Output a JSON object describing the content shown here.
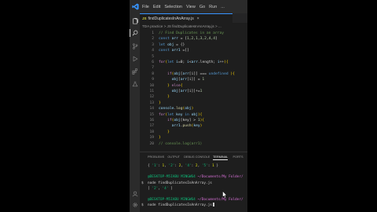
{
  "menu": [
    "File",
    "Edit",
    "Selection",
    "View",
    "Go",
    "Run",
    "..."
  ],
  "tab": {
    "badge": "JS",
    "label": "findDuplicatesInAnArray.js",
    "close": "×"
  },
  "breadcrumb": "TDA practice > JS findDuplicatesInAnArray.js > ...",
  "code_lines": [
    {
      "n": "1",
      "tokens": [
        {
          "t": "// Find Duplicates in an array",
          "c": "cmt"
        }
      ]
    },
    {
      "n": "2",
      "tokens": [
        {
          "t": "const ",
          "c": "kw"
        },
        {
          "t": "arr",
          "c": "var"
        },
        {
          "t": " = [",
          "c": "pun"
        },
        {
          "t": "1,2,1,3,2,4,4",
          "c": "num"
        },
        {
          "t": "]",
          "c": "pun"
        }
      ]
    },
    {
      "n": "3",
      "tokens": [
        {
          "t": "let ",
          "c": "kw"
        },
        {
          "t": "obj",
          "c": "var"
        },
        {
          "t": " = {}",
          "c": "pun"
        }
      ]
    },
    {
      "n": "4",
      "tokens": [
        {
          "t": "const ",
          "c": "kw"
        },
        {
          "t": "arr1",
          "c": "var"
        },
        {
          "t": " =[]",
          "c": "pun"
        }
      ]
    },
    {
      "n": "5",
      "tokens": []
    },
    {
      "n": "6",
      "tokens": [
        {
          "t": "for",
          "c": "ctl"
        },
        {
          "t": "(",
          "c": "br"
        },
        {
          "t": "let ",
          "c": "kw"
        },
        {
          "t": "i",
          "c": "var"
        },
        {
          "t": "=0; ",
          "c": "pun"
        },
        {
          "t": "i",
          "c": "var"
        },
        {
          "t": "<",
          "c": "pun"
        },
        {
          "t": "arr",
          "c": "var"
        },
        {
          "t": ".length; ",
          "c": "pun"
        },
        {
          "t": "i",
          "c": "var"
        },
        {
          "t": "++",
          "c": "pun"
        },
        {
          "t": "){",
          "c": "br"
        }
      ]
    },
    {
      "n": "7",
      "tokens": []
    },
    {
      "n": "8",
      "tokens": [
        {
          "t": "    if",
          "c": "ctl"
        },
        {
          "t": "(",
          "c": "br"
        },
        {
          "t": "obj",
          "c": "var"
        },
        {
          "t": "[",
          "c": "pun"
        },
        {
          "t": "arr",
          "c": "var"
        },
        {
          "t": "[i]] === ",
          "c": "pun"
        },
        {
          "t": "undefined",
          "c": "kw"
        },
        {
          "t": " ){",
          "c": "br"
        }
      ]
    },
    {
      "n": "9",
      "tokens": [
        {
          "t": "      obj",
          "c": "var"
        },
        {
          "t": "[",
          "c": "pun"
        },
        {
          "t": "arr",
          "c": "var"
        },
        {
          "t": "[i]] = ",
          "c": "pun"
        },
        {
          "t": "1",
          "c": "num"
        }
      ]
    },
    {
      "n": "10",
      "tokens": [
        {
          "t": "    } ",
          "c": "br"
        },
        {
          "t": "else",
          "c": "ctl"
        },
        {
          "t": "{",
          "c": "br"
        }
      ]
    },
    {
      "n": "11",
      "tokens": [
        {
          "t": "      obj",
          "c": "var"
        },
        {
          "t": "[",
          "c": "pun"
        },
        {
          "t": "arr",
          "c": "var"
        },
        {
          "t": "[i]]+=",
          "c": "pun"
        },
        {
          "t": "1",
          "c": "num"
        }
      ]
    },
    {
      "n": "12",
      "tokens": [
        {
          "t": "    }",
          "c": "br"
        }
      ]
    },
    {
      "n": "13",
      "tokens": [
        {
          "t": "}",
          "c": "br"
        }
      ]
    },
    {
      "n": "14",
      "tokens": [
        {
          "t": "console",
          "c": "var"
        },
        {
          "t": ".",
          "c": "pun"
        },
        {
          "t": "log",
          "c": "fn"
        },
        {
          "t": "(",
          "c": "br"
        },
        {
          "t": "obj",
          "c": "var"
        },
        {
          "t": ")",
          "c": "br"
        }
      ]
    },
    {
      "n": "15",
      "tokens": [
        {
          "t": "for",
          "c": "ctl"
        },
        {
          "t": "(",
          "c": "br"
        },
        {
          "t": "let ",
          "c": "kw"
        },
        {
          "t": "key",
          "c": "var"
        },
        {
          "t": " in ",
          "c": "kw"
        },
        {
          "t": "obj",
          "c": "var"
        },
        {
          "t": "){",
          "c": "br"
        }
      ]
    },
    {
      "n": "16",
      "tokens": [
        {
          "t": "    if",
          "c": "ctl"
        },
        {
          "t": "(",
          "c": "br"
        },
        {
          "t": "obj",
          "c": "var"
        },
        {
          "t": "[key] > ",
          "c": "pun"
        },
        {
          "t": "1",
          "c": "num"
        },
        {
          "t": "){",
          "c": "br"
        }
      ]
    },
    {
      "n": "17",
      "tokens": [
        {
          "t": "      arr1",
          "c": "var"
        },
        {
          "t": ".",
          "c": "pun"
        },
        {
          "t": "push",
          "c": "fn"
        },
        {
          "t": "(",
          "c": "br"
        },
        {
          "t": "key",
          "c": "var"
        },
        {
          "t": ")",
          "c": "br"
        }
      ]
    },
    {
      "n": "18",
      "tokens": [
        {
          "t": "    }",
          "c": "br"
        }
      ]
    },
    {
      "n": "19",
      "tokens": [
        {
          "t": "}",
          "c": "br"
        }
      ]
    },
    {
      "n": "20",
      "tokens": [
        {
          "t": "// console.log(arr1)",
          "c": "cmt"
        }
      ]
    }
  ],
  "panel_tabs": [
    "PROBLEMS",
    "OUTPUT",
    "DEBUG CONSOLE",
    "TERMINAL",
    "PORTS"
  ],
  "panel_active": "TERMINAL",
  "terminal_lines": [
    {
      "prompt": "",
      "tokens": [
        {
          "t": "{ ",
          "c": ""
        },
        {
          "t": "'1'",
          "c": "str"
        },
        {
          "t": ": ",
          "c": ""
        },
        {
          "t": "1",
          "c": "num"
        },
        {
          "t": ", ",
          "c": ""
        },
        {
          "t": "'2'",
          "c": "str"
        },
        {
          "t": ": ",
          "c": ""
        },
        {
          "t": "2",
          "c": "num"
        },
        {
          "t": ", ",
          "c": ""
        },
        {
          "t": "'4'",
          "c": "str"
        },
        {
          "t": ": ",
          "c": ""
        },
        {
          "t": "2",
          "c": "num"
        },
        {
          "t": ", ",
          "c": ""
        },
        {
          "t": "'5'",
          "c": "str"
        },
        {
          "t": ": ",
          "c": ""
        },
        {
          "t": "1",
          "c": "num"
        },
        {
          "t": " }",
          "c": ""
        }
      ]
    },
    {
      "prompt": "",
      "tokens": []
    },
    {
      "prompt": "",
      "tokens": [
        {
          "t": "@DESKTOP-M5IABU MINGW64 ",
          "c": "user"
        },
        {
          "t": "~/Documents/My Folder/",
          "c": "path"
        }
      ]
    },
    {
      "prompt": "$",
      "tokens": [
        {
          "t": "node findDuplicatesInAnArray.js",
          "c": ""
        }
      ]
    },
    {
      "prompt": "",
      "tokens": [
        {
          "t": "[ ",
          "c": ""
        },
        {
          "t": "'2'",
          "c": "str"
        },
        {
          "t": ", ",
          "c": ""
        },
        {
          "t": "'4'",
          "c": "str"
        },
        {
          "t": " ]",
          "c": ""
        }
      ]
    },
    {
      "prompt": "",
      "tokens": []
    },
    {
      "prompt": "",
      "tokens": [
        {
          "t": "@DESKTOP-M5IABU MINGW64 ",
          "c": "user"
        },
        {
          "t": "~/Documents/My Folder/",
          "c": "path"
        }
      ]
    },
    {
      "prompt": "$",
      "tokens": [
        {
          "t": "node findDuplicatesInAnArray.js",
          "c": ""
        }
      ],
      "cursor": true
    }
  ]
}
